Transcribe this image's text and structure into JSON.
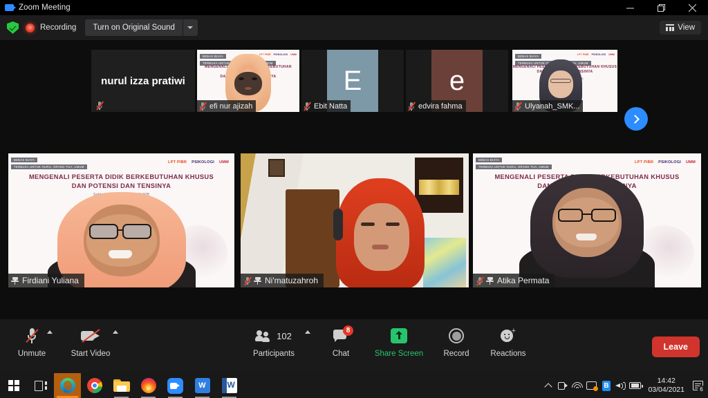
{
  "window": {
    "title": "Zoom Meeting",
    "app_icon": "zoom-video-icon",
    "minimize": "minimize-icon",
    "maximize": "restore-icon",
    "close": "close-icon"
  },
  "topbar": {
    "encryption_icon": "green-shield-check-icon",
    "recording_icon": "recording-dot-icon",
    "recording_label": "Recording",
    "original_sound_label": "Turn on Original Sound",
    "original_sound_caret": "chevron-down-icon",
    "view_icon": "grid-view-icon",
    "view_label": "View",
    "accent_blue": "#2d8cff",
    "recording_red": "#e3382b",
    "shield_green": "#28c840"
  },
  "filmstrip": {
    "next_arrow_icon": "chevron-right-icon",
    "tiles": [
      {
        "name": "nurul izza pratiwi",
        "kind": "name-only",
        "muted": true,
        "show_label": false
      },
      {
        "name": "efi nur ajizah",
        "kind": "video",
        "muted": true,
        "show_label": true
      },
      {
        "name": "Ebit Natta",
        "kind": "initial",
        "initial": "E",
        "color": "#7d98a6",
        "muted": true,
        "show_label": true
      },
      {
        "name": "edvira fahma",
        "kind": "initial",
        "initial": "e",
        "color": "#6b4038",
        "muted": true,
        "show_label": true
      },
      {
        "name": "Ulyanah_SMK...",
        "kind": "video",
        "muted": true,
        "show_label": true
      }
    ]
  },
  "poster": {
    "ribbon1": "BEBAS BIAYA",
    "ribbon2": "TERBUKA UNTUK GURU, ORANG TUA, UMUM",
    "title_line1": "MENGENALI PESERTA DIDIK BERKEBUTUHAN KHUSUS",
    "title_line2": "DAN POTENSI DAN TENSINYA",
    "date": "Sabtu, 3 April 2021   |   09.00 WIB",
    "logos": [
      "LPT PIBR",
      "PSIKOLOGI",
      "UMM"
    ]
  },
  "gallery": {
    "tiles": [
      {
        "name": "Firdiani Yuliana",
        "muted": true,
        "pinned": true,
        "active_speaker": true,
        "background": "poster"
      },
      {
        "name": "Ni'matuzahroh",
        "muted": true,
        "pinned": true,
        "active_speaker": false,
        "background": "room"
      },
      {
        "name": "Atika Permata",
        "muted": true,
        "pinned": true,
        "active_speaker": false,
        "background": "poster"
      }
    ],
    "active_border_color": "#b8e22f"
  },
  "toolbar": {
    "items": [
      {
        "id": "audio",
        "label": "Unmute",
        "icon": "microphone-muted-icon",
        "has_caret": true,
        "green": false
      },
      {
        "id": "video",
        "label": "Start Video",
        "icon": "camera-off-icon",
        "has_caret": true,
        "green": false
      },
      {
        "id": "participants",
        "label": "Participants",
        "icon": "participants-icon",
        "count": "102",
        "has_caret": true,
        "green": false
      },
      {
        "id": "chat",
        "label": "Chat",
        "icon": "chat-bubble-icon",
        "badge": "8",
        "has_caret": false,
        "green": false
      },
      {
        "id": "share",
        "label": "Share Screen",
        "icon": "share-screen-icon",
        "has_caret": false,
        "green": true
      },
      {
        "id": "record",
        "label": "Record",
        "icon": "record-circle-icon",
        "has_caret": false,
        "green": false
      },
      {
        "id": "reactions",
        "label": "Reactions",
        "icon": "reactions-smiley-icon",
        "has_caret": false,
        "green": false
      }
    ],
    "leave_label": "Leave",
    "leave_color": "#d0342c",
    "share_green": "#27c46b",
    "badge_red": "#e3382b"
  },
  "taskbar": {
    "apps": [
      {
        "id": "start",
        "icon": "windows-start-icon",
        "state": "none"
      },
      {
        "id": "taskview",
        "icon": "task-view-icon",
        "state": "none"
      },
      {
        "id": "edge",
        "icon": "microsoft-edge-icon",
        "state": "active"
      },
      {
        "id": "chrome",
        "icon": "google-chrome-icon",
        "state": "none"
      },
      {
        "id": "explorer",
        "icon": "file-explorer-icon",
        "state": "open"
      },
      {
        "id": "firefox",
        "icon": "firefox-icon",
        "state": "open"
      },
      {
        "id": "zoom",
        "icon": "zoom-icon",
        "state": "open"
      },
      {
        "id": "wps",
        "icon": "wps-office-icon",
        "state": "open"
      },
      {
        "id": "word",
        "icon": "microsoft-word-icon",
        "state": "open"
      }
    ],
    "tray": {
      "overflow_icon": "chevron-up-icon",
      "camera_icon": "camera-tray-icon",
      "wifi_icon": "wifi-icon",
      "cast_icon": "display-cast-icon",
      "bluetooth_icon": "bluetooth-icon",
      "volume_icon": "speaker-icon",
      "battery_icon": "battery-icon",
      "time": "14:42",
      "date": "03/04/2021",
      "notification_icon": "action-center-icon",
      "notification_count": "6"
    }
  }
}
